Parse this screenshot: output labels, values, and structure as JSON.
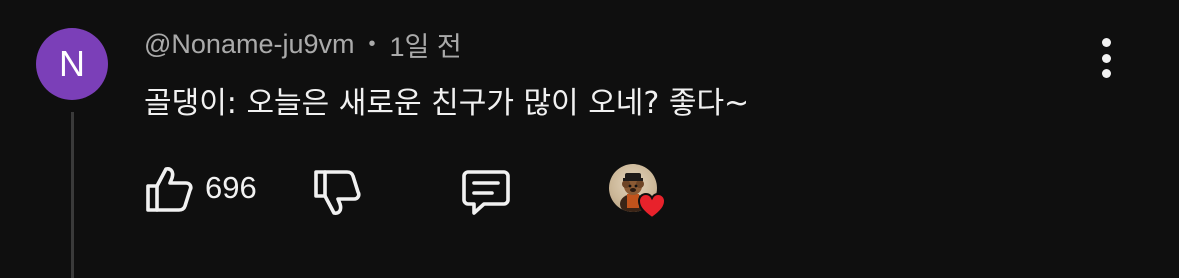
{
  "comment": {
    "avatar_initial": "N",
    "author": "@Noname-ju9vm",
    "separator": "•",
    "timestamp": "1일 전",
    "text": "골댕이: 오늘은 새로운 친구가 많이 오네? 좋다~",
    "like_count": "696",
    "avatar_color": "#7b3fb8",
    "heart_color": "#e8222b"
  },
  "icons": {
    "more": "more-vertical-icon",
    "like": "thumbs-up-icon",
    "dislike": "thumbs-down-icon",
    "reply": "comment-icon",
    "creator_heart": "creator-heart-icon"
  }
}
